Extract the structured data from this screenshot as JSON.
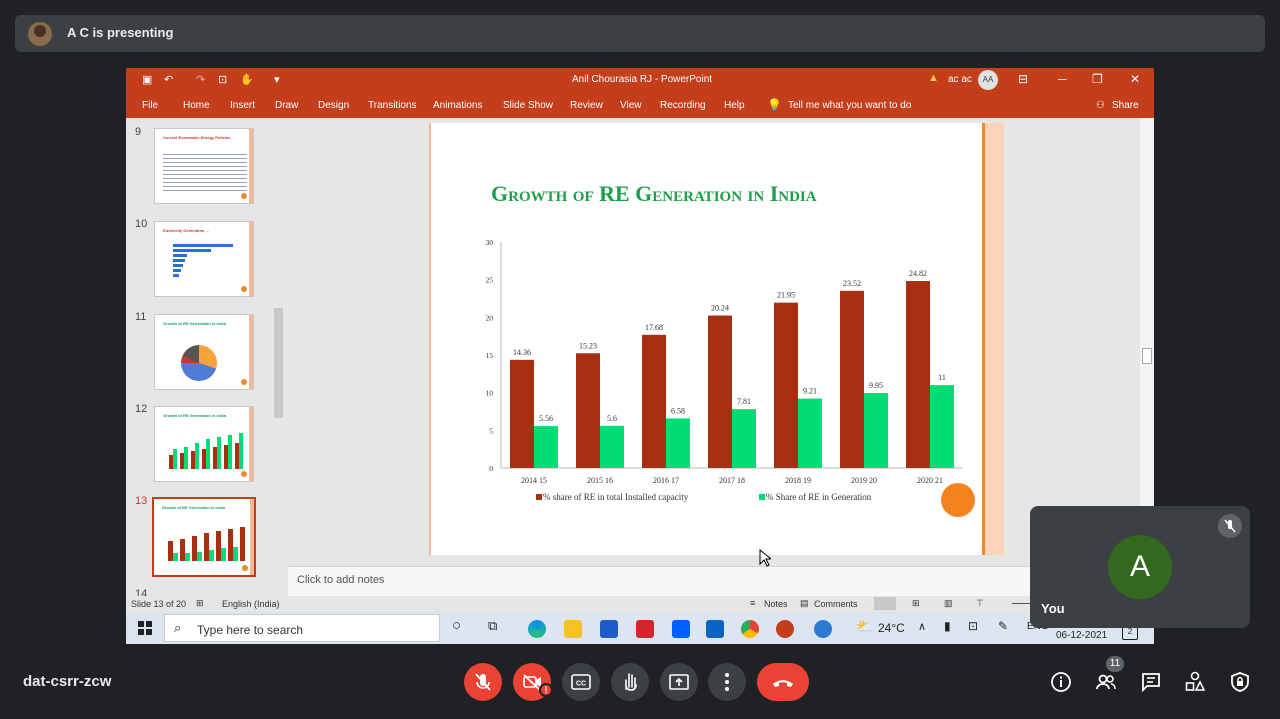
{
  "presenter": {
    "name": "A C is presenting"
  },
  "ppt": {
    "title": "Anil Chourasia RJ  -  PowerPoint",
    "warning_user": "ac ac",
    "user_initials": "AA",
    "menu": [
      "File",
      "Home",
      "Insert",
      "Draw",
      "Design",
      "Transitions",
      "Animations",
      "Slide Show",
      "Review",
      "View",
      "Recording",
      "Help"
    ],
    "tell_me": "Tell me what you want to do",
    "share": "Share",
    "thumbnails": [
      {
        "num": "9",
        "title": "Current Renewable Energy Policies"
      },
      {
        "num": "10",
        "title": "Electricity Generation ..."
      },
      {
        "num": "11",
        "title": "Growth of RE Generation in India"
      },
      {
        "num": "12",
        "title": "Growth of RE Generation in India"
      },
      {
        "num": "13",
        "title": "Growth of RE Generation in India"
      },
      {
        "num": "14",
        "title": ""
      }
    ],
    "notes_placeholder": "Click to add notes",
    "status": {
      "slide": "Slide 13 of 20",
      "language": "English (India)",
      "notes": "Notes",
      "comments": "Comments"
    }
  },
  "slide": {
    "title": "Growth of RE Generation in India"
  },
  "chart_data": {
    "type": "bar",
    "categories": [
      "2014 15",
      "2015 16",
      "2016 17",
      "2017 18",
      "2018 19",
      "2019 20",
      "2020 21"
    ],
    "series": [
      {
        "name": "% share of RE in total Installed capacity",
        "values": [
          14.36,
          15.23,
          17.68,
          20.24,
          21.95,
          23.52,
          24.82
        ],
        "color": "#a6300f"
      },
      {
        "name": "% Share of RE in Generation",
        "values": [
          5.56,
          5.6,
          6.58,
          7.81,
          9.21,
          9.95,
          11
        ],
        "color": "#00dd76"
      }
    ],
    "value_labels": [
      [
        "14.36",
        "15.23",
        "17.68",
        "20.24",
        "21.95",
        "23.52",
        "24.82"
      ],
      [
        "5.56",
        "5.6",
        "6.58",
        "7.81",
        "9.21",
        "9.95",
        "11"
      ]
    ],
    "ylim": [
      0,
      30
    ],
    "yticks": [
      "0",
      "5",
      "10",
      "15",
      "20",
      "25",
      "30"
    ],
    "legend_position": "bottom",
    "grid": false
  },
  "taskbar": {
    "search_placeholder": "Type here to search",
    "weather": "24°C",
    "lang": "ENG",
    "date": "06-12-2021",
    "notif_count": "2"
  },
  "self_tile": {
    "initial": "A",
    "name": "You"
  },
  "meeting": {
    "code": "dat-csrr-zcw",
    "participants_count": "11"
  },
  "colors": {
    "accent": "#c43e1c",
    "end_call": "#ea4335",
    "meet_bg": "#202124"
  }
}
